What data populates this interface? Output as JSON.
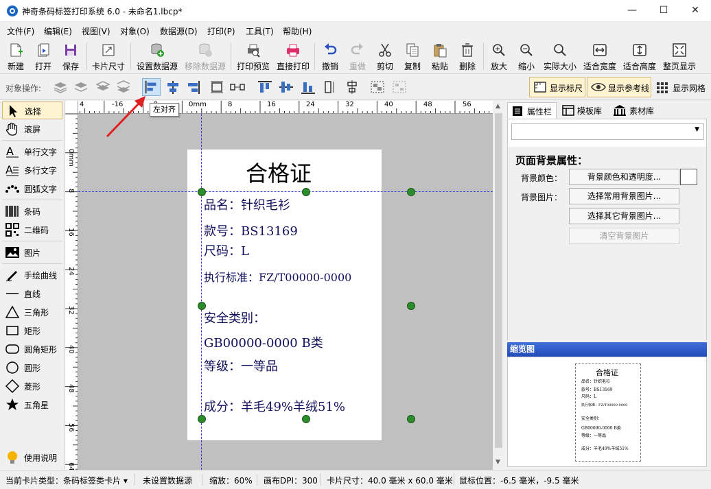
{
  "window": {
    "title": "神奇条码标签打印系统 6.0 - 未命名1.lbcp*"
  },
  "menu": [
    "文件(F)",
    "编辑(E)",
    "视图(V)",
    "对象(O)",
    "数据源(D)",
    "打印(P)",
    "工具(T)",
    "帮助(H)"
  ],
  "toolbar": {
    "new": "新建",
    "open": "打开",
    "save": "保存",
    "card_size": "卡片尺寸",
    "set_datasource": "设置数据源",
    "remove_datasource": "移除数据源",
    "print_preview": "打印预览",
    "direct_print": "直接打印",
    "undo": "撤销",
    "redo": "重做",
    "cut": "剪切",
    "copy": "复制",
    "paste": "粘贴",
    "delete": "删除",
    "zoom_in": "放大",
    "zoom_out": "缩小",
    "actual_size": "实际大小",
    "fit_width": "适合宽度",
    "fit_height": "适合高度",
    "fit_page": "整页显示"
  },
  "objbar": {
    "label": "对象操作:",
    "show_ruler": "显示标尺",
    "show_guides": "显示参考线",
    "show_grid": "显示网格"
  },
  "tooltip": "左对齐",
  "tools": {
    "select": "选择",
    "scroll": "滚屏",
    "single_text": "单行文字",
    "multi_text": "多行文字",
    "arc_text": "圆弧文字",
    "barcode": "条码",
    "qrcode": "二维码",
    "image": "图片",
    "freehand": "手绘曲线",
    "line": "直线",
    "triangle": "三角形",
    "rect": "矩形",
    "round_rect": "圆角矩形",
    "circle": "圆形",
    "diamond": "菱形",
    "star": "五角星",
    "help": "使用说明"
  },
  "ruler": {
    "top": [
      "4",
      "-16",
      "-8",
      "0mm",
      "8",
      "16",
      "24",
      "32",
      "40",
      "48",
      "56"
    ],
    "left": [
      "0mm",
      "8",
      "16",
      "24",
      "32",
      "40",
      "48",
      "56",
      "64"
    ]
  },
  "label": {
    "title": "合格证",
    "lines": [
      "品名：针织毛衫",
      "款号：BS13169",
      "尺码：L",
      "执行标准：FZ/T00000-0000",
      "安全类别：",
      "GB00000-0000 B类",
      "等级：一等品",
      "成分：羊毛49%羊绒51%"
    ]
  },
  "panel": {
    "tabs": [
      "属性栏",
      "模板库",
      "素材库"
    ],
    "section_title": "页面背景属性：",
    "bg_color_label": "背景颜色：",
    "bg_image_label": "背景图片：",
    "btn_color": "背景颜色和透明度...",
    "btn_common_image": "选择常用背景图片...",
    "btn_other_image": "选择其它背景图片...",
    "btn_clear_image": "清空背景图片",
    "preview_title": "缩览图"
  },
  "status": {
    "card_type": "当前卡片类型：条码标签类卡片 ▾",
    "datasource": "未设置数据源",
    "zoom": "缩放：60%",
    "dpi": "画布DPI：300",
    "card_size": "卡片尺寸：40.0 毫米 x 60.0 毫米",
    "mouse_pos": "鼠标位置：-6.5 毫米，-9.5 毫米"
  },
  "colors": {
    "accent": "#2a52be",
    "label_text": "#10105c",
    "handle": "#2c8c2c",
    "arrow": "#e02020"
  }
}
